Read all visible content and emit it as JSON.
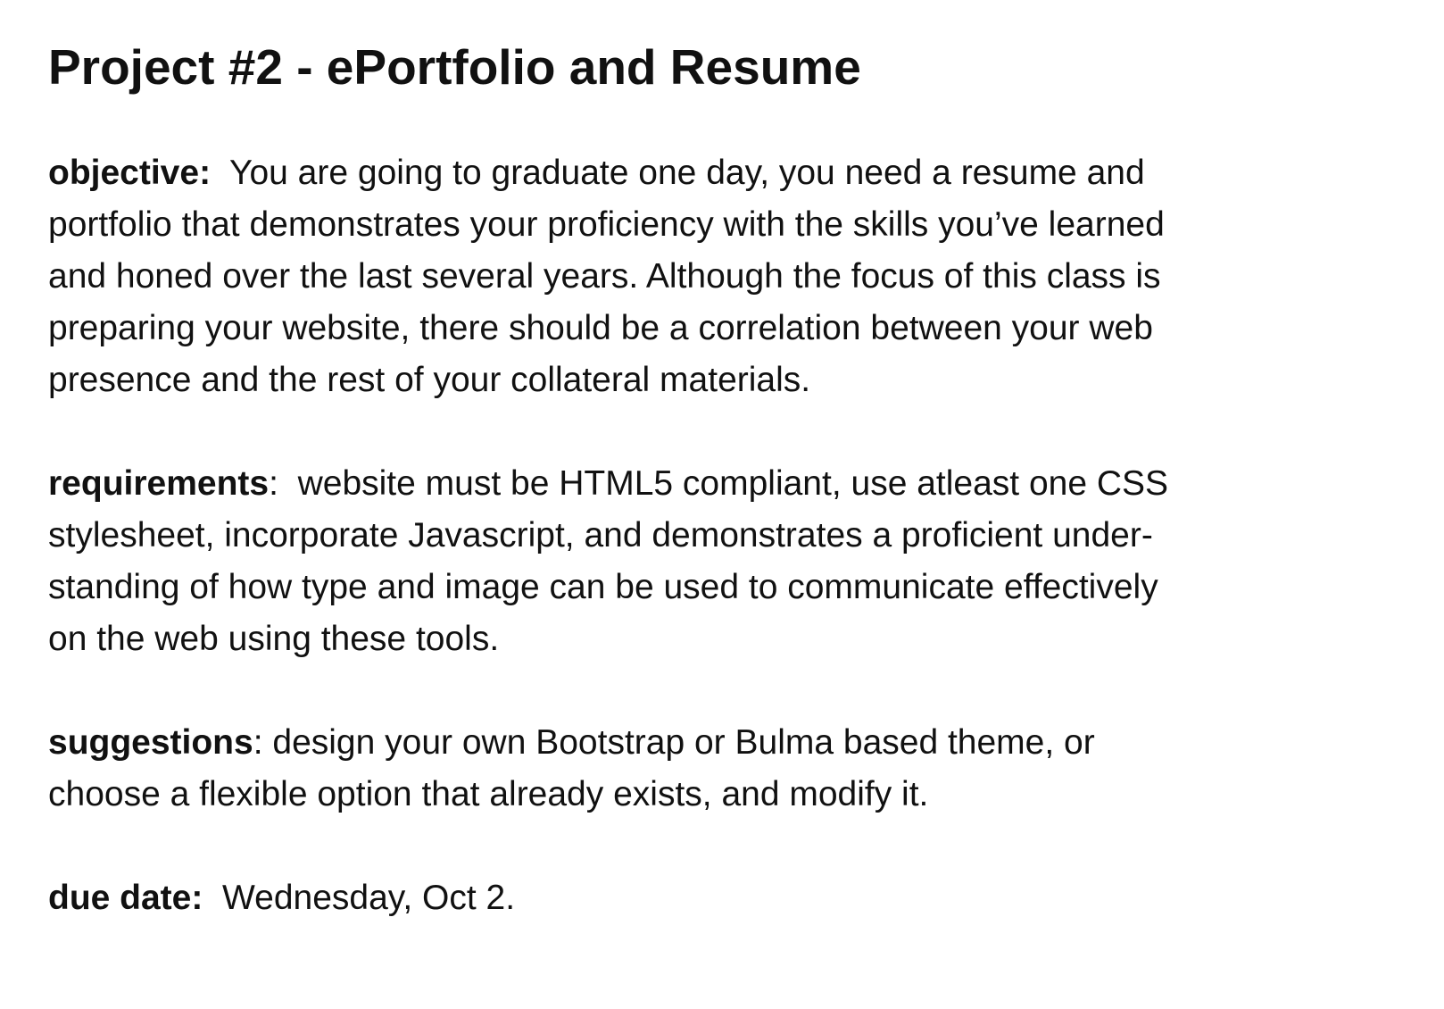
{
  "document": {
    "title": "Project #2 - ePortfolio and Resume",
    "sections": [
      {
        "label": "objective:",
        "lines": [
          "  You are going to graduate one day, you need a resume and",
          "portfolio that demonstrates your proficiency with the skills you’ve learned",
          "and honed over the last several years. Although the focus of this class is",
          "preparing your website, there should be a correlation between your web",
          "presence and the rest of your collateral materials."
        ]
      },
      {
        "label": "requirements",
        "lines": [
          ":  website must be HTML5 compliant, use atleast one CSS",
          "stylesheet, incorporate Javascript, and demonstrates a proficient under-",
          "standing of how type and image can be used to communicate effectively",
          "on the web using these tools."
        ]
      },
      {
        "label": "suggestions",
        "lines": [
          ": design your own Bootstrap or Bulma based theme, or",
          "choose a flexible option that already exists, and modify it."
        ]
      },
      {
        "label": "due date:",
        "lines": [
          "  Wednesday, Oct 2."
        ]
      }
    ]
  }
}
